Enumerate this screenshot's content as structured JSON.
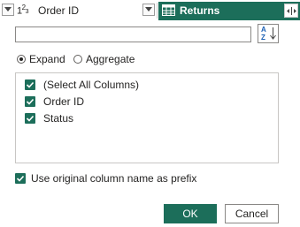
{
  "header": {
    "column1": {
      "type_icon": "123",
      "label": "Order ID"
    },
    "column2": {
      "label": "Returns",
      "icon": "table-icon",
      "expand_icon": "expand-column-icon"
    }
  },
  "search": {
    "value": "",
    "placeholder": ""
  },
  "sort_button": {
    "icon": "sort-az-icon",
    "text": "A Z"
  },
  "mode": {
    "options": [
      {
        "label": "Expand",
        "selected": true
      },
      {
        "label": "Aggregate",
        "selected": false
      }
    ]
  },
  "columns": {
    "items": [
      {
        "label": "(Select All Columns)",
        "checked": true
      },
      {
        "label": "Order ID",
        "checked": true
      },
      {
        "label": "Status",
        "checked": true
      }
    ]
  },
  "prefix_option": {
    "label": "Use original column name as prefix",
    "checked": true
  },
  "buttons": {
    "ok": "OK",
    "cancel": "Cancel"
  },
  "colors": {
    "accent": "#1c6e5a",
    "text": "#252423",
    "border": "#8a8886"
  }
}
